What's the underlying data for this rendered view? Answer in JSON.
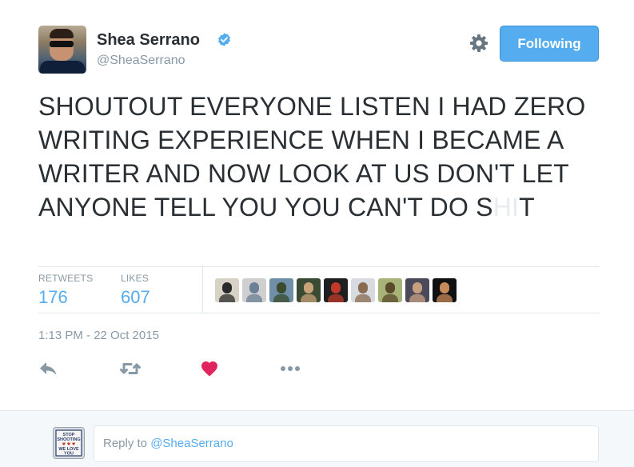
{
  "author": {
    "name": "Shea Serrano",
    "handle": "@SheaSerrano",
    "verified": true
  },
  "follow_button": {
    "label": "Following",
    "color": "#55acee"
  },
  "tweet": {
    "text_main": "SHOUTOUT EVERYONE LISTEN I HAD ZERO WRITING EXPERIENCE WHEN I BECAME A WRITER AND NOW LOOK AT US DON'T LET ANYONE TELL YOU YOU CAN'T DO S",
    "text_censored": "HI",
    "text_end": "T",
    "timestamp": "1:13 PM - 22 Oct 2015"
  },
  "stats": {
    "retweets_label": "RETWEETS",
    "retweets_value": "176",
    "likes_label": "LIKES",
    "likes_value": "607"
  },
  "likers": [
    {
      "name": "liker-1",
      "bg": "#d8d2c6",
      "fg": "#2a2a2a"
    },
    {
      "name": "liker-2",
      "bg": "#cfcfcf",
      "fg": "#6b7f96"
    },
    {
      "name": "liker-3",
      "bg": "#6f8fa8",
      "fg": "#3a4a2a"
    },
    {
      "name": "liker-4",
      "bg": "#3b4a32",
      "fg": "#c9a27a"
    },
    {
      "name": "liker-5",
      "bg": "#1f1f1f",
      "fg": "#c0392b"
    },
    {
      "name": "liker-6",
      "bg": "#d7dbe0",
      "fg": "#8a6a50"
    },
    {
      "name": "liker-7",
      "bg": "#a8b37a",
      "fg": "#5a4a2a"
    },
    {
      "name": "liker-8",
      "bg": "#4a4a5a",
      "fg": "#c8a080"
    },
    {
      "name": "liker-9",
      "bg": "#111111",
      "fg": "#c98a5a"
    }
  ],
  "actions": {
    "reply_icon": "reply-icon",
    "retweet_icon": "retweet-icon",
    "like_icon": "heart-icon",
    "like_color": "#e0245e",
    "more_icon": "more-icon"
  },
  "reply_box": {
    "prefix": "Reply to ",
    "mention": "@SheaSerrano"
  },
  "my_avatar": {
    "line1": "STOP",
    "line2": "SHOOTING",
    "line3": "♥ ♥ ♥",
    "line4": "WE LOVE",
    "line5": "YOU"
  }
}
